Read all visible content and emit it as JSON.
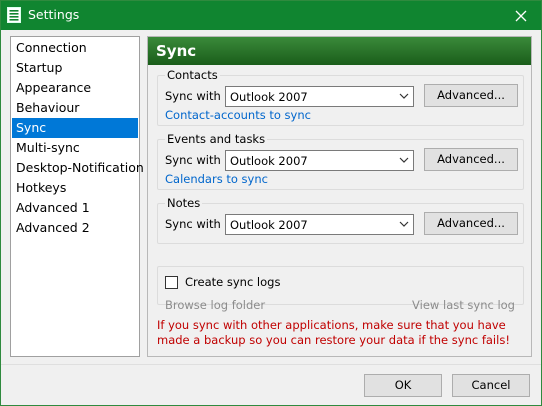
{
  "window": {
    "title": "Settings"
  },
  "sidebar": {
    "items": [
      {
        "label": "Connection"
      },
      {
        "label": "Startup"
      },
      {
        "label": "Appearance"
      },
      {
        "label": "Behaviour"
      },
      {
        "label": "Sync",
        "selected": true
      },
      {
        "label": "Multi-sync"
      },
      {
        "label": "Desktop-Notification"
      },
      {
        "label": "Hotkeys"
      },
      {
        "label": "Advanced 1"
      },
      {
        "label": "Advanced 2"
      }
    ]
  },
  "panel": {
    "title": "Sync",
    "contacts": {
      "label": "Contacts",
      "sync_label": "Sync with",
      "sync_value": "Outlook 2007",
      "advanced": "Advanced...",
      "link": "Contact-accounts to sync"
    },
    "events": {
      "label": "Events and tasks",
      "sync_label": "Sync with",
      "sync_value": "Outlook 2007",
      "advanced": "Advanced...",
      "link": "Calendars to sync"
    },
    "notes": {
      "label": "Notes",
      "sync_label": "Sync with",
      "sync_value": "Outlook 2007",
      "advanced": "Advanced..."
    },
    "logs": {
      "checkbox_label": "Create sync logs",
      "checked": false,
      "browse": "Browse log folder",
      "view_last": "View last sync log"
    },
    "warning": "If you sync with other applications, make sure that you have made a backup so you can restore your data if the sync fails!"
  },
  "footer": {
    "ok": "OK",
    "cancel": "Cancel"
  },
  "colors": {
    "titlebar": "#108530",
    "header": "#2a7a2a",
    "selection": "#0078d7",
    "link": "#0066cc",
    "warning": "#c00000"
  }
}
